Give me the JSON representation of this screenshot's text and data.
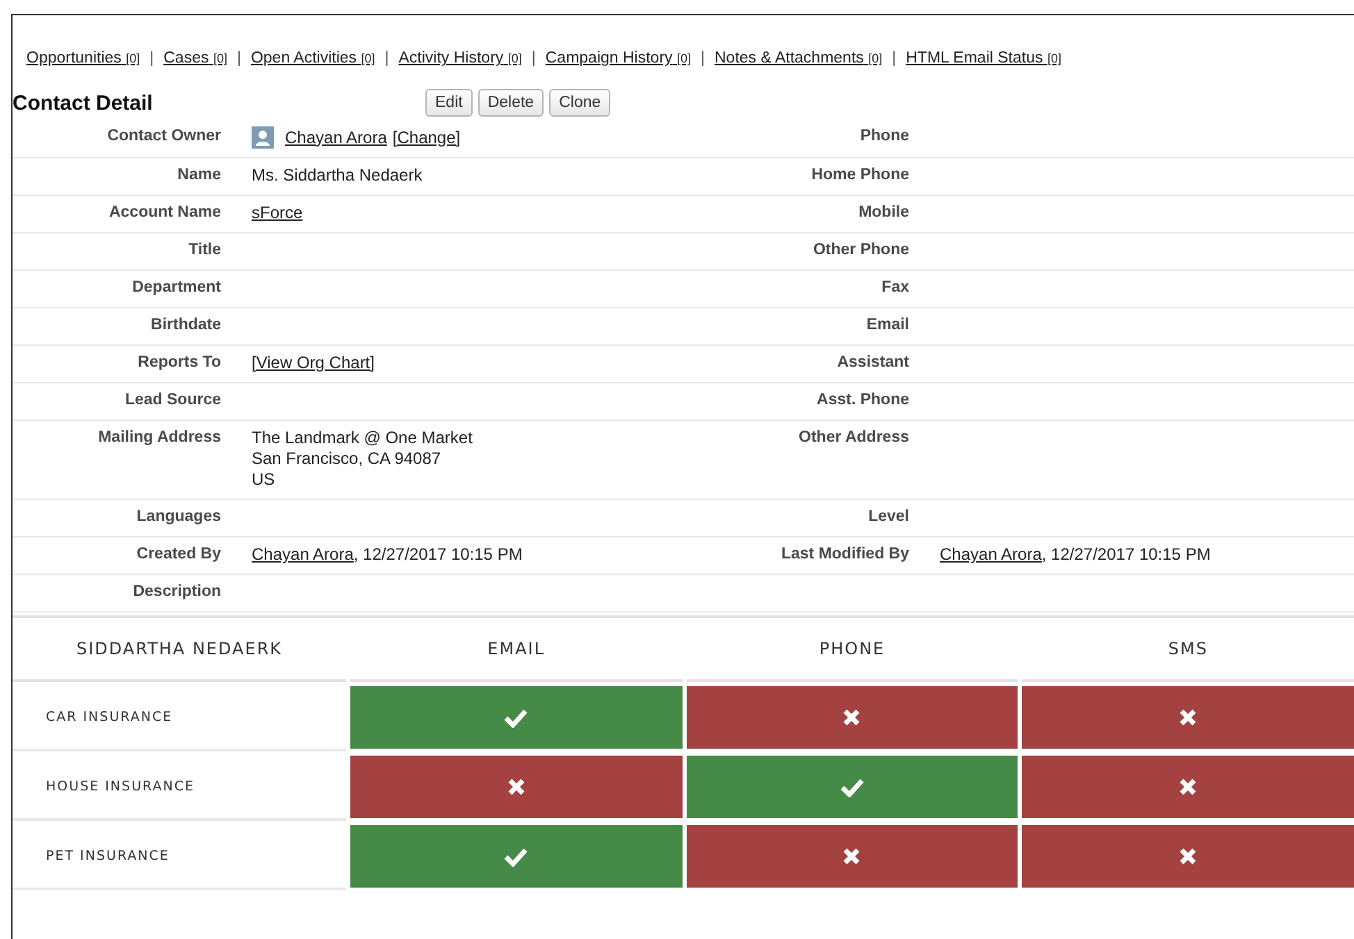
{
  "related_links": [
    {
      "label": "Opportunities",
      "count": "[0]"
    },
    {
      "label": "Cases",
      "count": "[0]"
    },
    {
      "label": "Open Activities",
      "count": "[0]"
    },
    {
      "label": "Activity History",
      "count": "[0]"
    },
    {
      "label": "Campaign History",
      "count": "[0]"
    },
    {
      "label": "Notes & Attachments",
      "count": "[0]"
    },
    {
      "label": "HTML Email Status",
      "count": "[0]"
    }
  ],
  "separator": "|",
  "detail": {
    "title": "Contact Detail",
    "buttons": [
      "Edit",
      "Delete",
      "Clone"
    ],
    "rows": [
      {
        "left": {
          "label": "Contact Owner",
          "kind": "owner",
          "lines": [
            [
              {
                "text": "Chayan Arora",
                "link": true
              },
              {
                "text": "[Change]",
                "link": true
              }
            ]
          ]
        },
        "right": {
          "label": "Phone"
        }
      },
      {
        "left": {
          "label": "Name",
          "lines": [
            [
              {
                "text": "Ms. Siddartha Nedaerk",
                "link": false
              }
            ]
          ]
        },
        "right": {
          "label": "Home Phone"
        }
      },
      {
        "left": {
          "label": "Account Name",
          "lines": [
            [
              {
                "text": "sForce",
                "link": true
              }
            ]
          ]
        },
        "right": {
          "label": "Mobile"
        }
      },
      {
        "left": {
          "label": "Title"
        },
        "right": {
          "label": "Other Phone"
        }
      },
      {
        "left": {
          "label": "Department"
        },
        "right": {
          "label": "Fax"
        }
      },
      {
        "left": {
          "label": "Birthdate"
        },
        "right": {
          "label": "Email"
        }
      },
      {
        "left": {
          "label": "Reports To",
          "lines": [
            [
              {
                "text": "[View Org Chart]",
                "link": true
              }
            ]
          ]
        },
        "right": {
          "label": "Assistant"
        }
      },
      {
        "left": {
          "label": "Lead Source"
        },
        "right": {
          "label": "Asst. Phone"
        }
      },
      {
        "left": {
          "label": "Mailing Address",
          "lines": [
            [
              {
                "text": "The Landmark @ One Market",
                "link": false
              }
            ],
            [
              {
                "text": "San Francisco, CA 94087",
                "link": false
              }
            ],
            [
              {
                "text": "US",
                "link": false
              }
            ]
          ]
        },
        "right": {
          "label": "Other Address"
        }
      },
      {
        "left": {
          "label": "Languages"
        },
        "right": {
          "label": "Level"
        }
      },
      {
        "left": {
          "label": "Created By",
          "lines": [
            [
              {
                "text": "Chayan Arora",
                "link": true
              },
              {
                "text": ", 12/27/2017 10:15 PM",
                "link": false
              }
            ]
          ]
        },
        "right": {
          "label": "Last Modified By",
          "lines": [
            [
              {
                "text": "Chayan Arora",
                "link": true
              },
              {
                "text": ", 12/27/2017 10:15 PM",
                "link": false
              }
            ]
          ]
        }
      },
      {
        "left": {
          "label": "Description"
        }
      }
    ]
  },
  "consent": {
    "heading": "SIDDARTHA NEDAERK",
    "columns": [
      "EMAIL",
      "PHONE",
      "SMS"
    ],
    "rows": [
      {
        "label": "CAR INSURANCE",
        "values": [
          true,
          false,
          false
        ]
      },
      {
        "label": "HOUSE INSURANCE",
        "values": [
          false,
          true,
          false
        ]
      },
      {
        "label": "PET INSURANCE",
        "values": [
          true,
          false,
          false
        ]
      }
    ]
  }
}
